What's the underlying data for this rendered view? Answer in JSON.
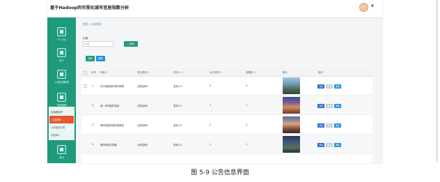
{
  "app": {
    "title": "基于Hadoop的可视化城市宜居指数分析"
  },
  "colors": {
    "primary": "#1f9a7c",
    "accent": "#e8552f",
    "link": "#2a8fd6"
  },
  "sidebar": {
    "items": [
      {
        "label": "个人中心",
        "icon": "user-icon"
      },
      {
        "label": "用户",
        "icon": "users-icon"
      },
      {
        "label": "公告信息管理",
        "icon": "bell-icon"
      },
      {
        "label": "系统管理",
        "icon": "settings-icon"
      },
      {
        "label": "退出",
        "icon": "logout-icon"
      }
    ],
    "submenu": [
      {
        "label": "轮播图管理"
      },
      {
        "label": "公告资讯"
      },
      {
        "label": "公告信息分类"
      },
      {
        "label": "系统简介"
      }
    ]
  },
  "breadcrumb": {
    "home": "首页",
    "sep": "/",
    "current": "公告资讯"
  },
  "search": {
    "label": "标题",
    "placeholder": "标题",
    "button": "查询"
  },
  "toolbar": {
    "add": "添加",
    "delete": "删除"
  },
  "table": {
    "headers": [
      "序号",
      "标题 ⇕",
      "发布类型 ⇕",
      "发布人 ⇕",
      "点击次数 ⇕",
      "收藏数 ⇕",
      "图片",
      "操作"
    ],
    "rows": [
      {
        "index": "1",
        "title": "关于宜居城市排行榜单",
        "type": "分类名称3",
        "author": "发布人3",
        "clicks": "3",
        "favs": "3"
      },
      {
        "index": "2",
        "title": "统一环境保护信息",
        "type": "分类名称7",
        "author": "发布人7",
        "clicks": "7",
        "favs": "7"
      },
      {
        "index": "3",
        "title": "城市宜居资源分析报告",
        "type": "分类名称2",
        "author": "发布人2",
        "clicks": "2",
        "favs": "2"
      },
      {
        "index": "4",
        "title": "城市规划与发展",
        "type": "分类名称1",
        "author": "发布人1",
        "clicks": "1",
        "favs": "1"
      }
    ],
    "actions": {
      "detail": "详情",
      "edit": "修改",
      "delete": "删除"
    }
  },
  "caption": "图 5-9 公告信息界面"
}
